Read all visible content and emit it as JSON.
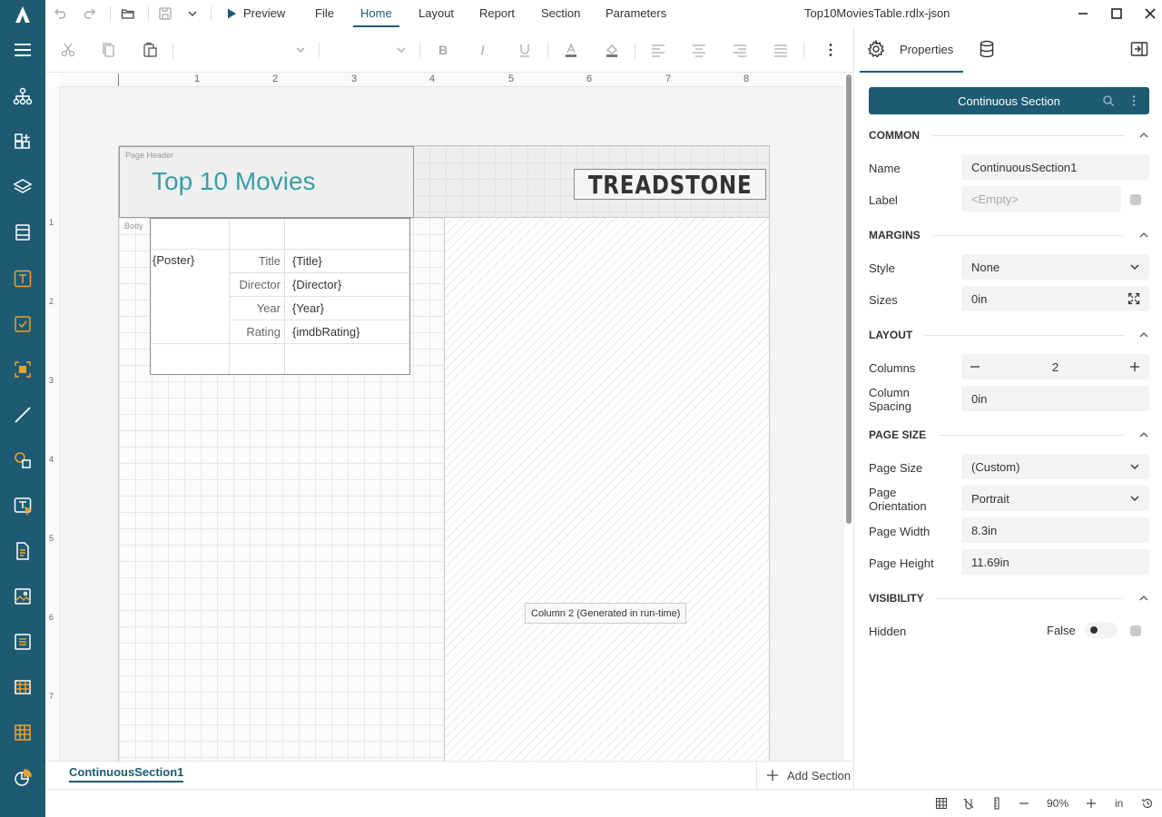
{
  "window": {
    "title": "Top10MoviesTable.rdlx-json"
  },
  "menu": {
    "preview": "Preview",
    "file": "File",
    "home": "Home",
    "layout": "Layout",
    "report": "Report",
    "section": "Section",
    "parameters": "Parameters"
  },
  "ruler": {
    "h": [
      "1",
      "2",
      "3",
      "4",
      "5",
      "6",
      "7",
      "8"
    ],
    "v": [
      "1",
      "2",
      "3",
      "4",
      "5",
      "6",
      "7"
    ]
  },
  "report": {
    "page_header_label": "Page Header",
    "title": "Top 10 Movies",
    "logo_text": "TREADSTONE",
    "body_label": "Body",
    "poster": "{Poster}",
    "rows": [
      {
        "label": "Title",
        "value": "{Title}"
      },
      {
        "label": "Director",
        "value": "{Director}"
      },
      {
        "label": "Year",
        "value": "{Year}"
      },
      {
        "label": "Rating",
        "value": "{imdbRating}"
      }
    ],
    "column2_label": "Column 2 (Generated in run-time)"
  },
  "bottom": {
    "section_tab": "ContinuousSection1",
    "add_section": "Add Section"
  },
  "status": {
    "zoom": "90%",
    "unit": "in"
  },
  "panel": {
    "tab_properties": "Properties",
    "section_title": "Continuous Section",
    "groups": {
      "common": "COMMON",
      "margins": "MARGINS",
      "layout": "LAYOUT",
      "page_size": "PAGE SIZE",
      "visibility": "VISIBILITY"
    },
    "name_label": "Name",
    "name_value": "ContinuousSection1",
    "label_label": "Label",
    "label_placeholder": "<Empty>",
    "style_label": "Style",
    "style_value": "None",
    "sizes_label": "Sizes",
    "sizes_value": "0in",
    "columns_label": "Columns",
    "columns_value": "2",
    "colspacing_label": "Column Spacing",
    "colspacing_value": "0in",
    "pagesize_label": "Page Size",
    "pagesize_value": "(Custom)",
    "orientation_label": "Page Orientation",
    "orientation_value": "Portrait",
    "width_label": "Page Width",
    "width_value": "8.3in",
    "height_label": "Page Height",
    "height_value": "11.69in",
    "hidden_label": "Hidden",
    "hidden_value": "False"
  },
  "colors": {
    "brand": "#1e5b73",
    "title_teal": "#3a9ea6",
    "accent_orange": "#f0a030"
  }
}
